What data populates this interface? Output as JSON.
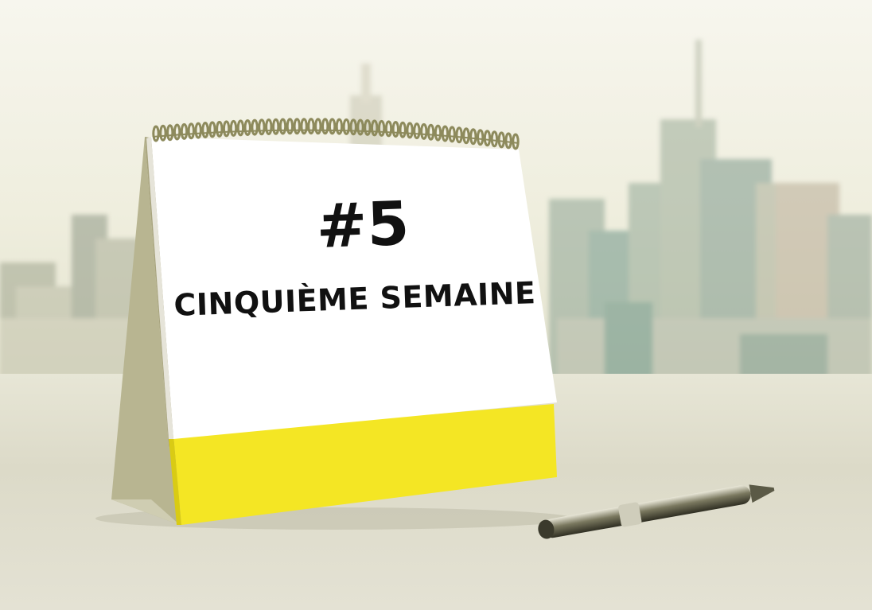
{
  "calendar": {
    "number": "#5",
    "label": "CINQUIÈME SEMAINE"
  },
  "colors": {
    "calendar_bottom": "#f4e624",
    "calendar_stand": "#b8b591",
    "spiral": "#8d8a5c",
    "page": "#ffffff",
    "text": "#111111"
  }
}
